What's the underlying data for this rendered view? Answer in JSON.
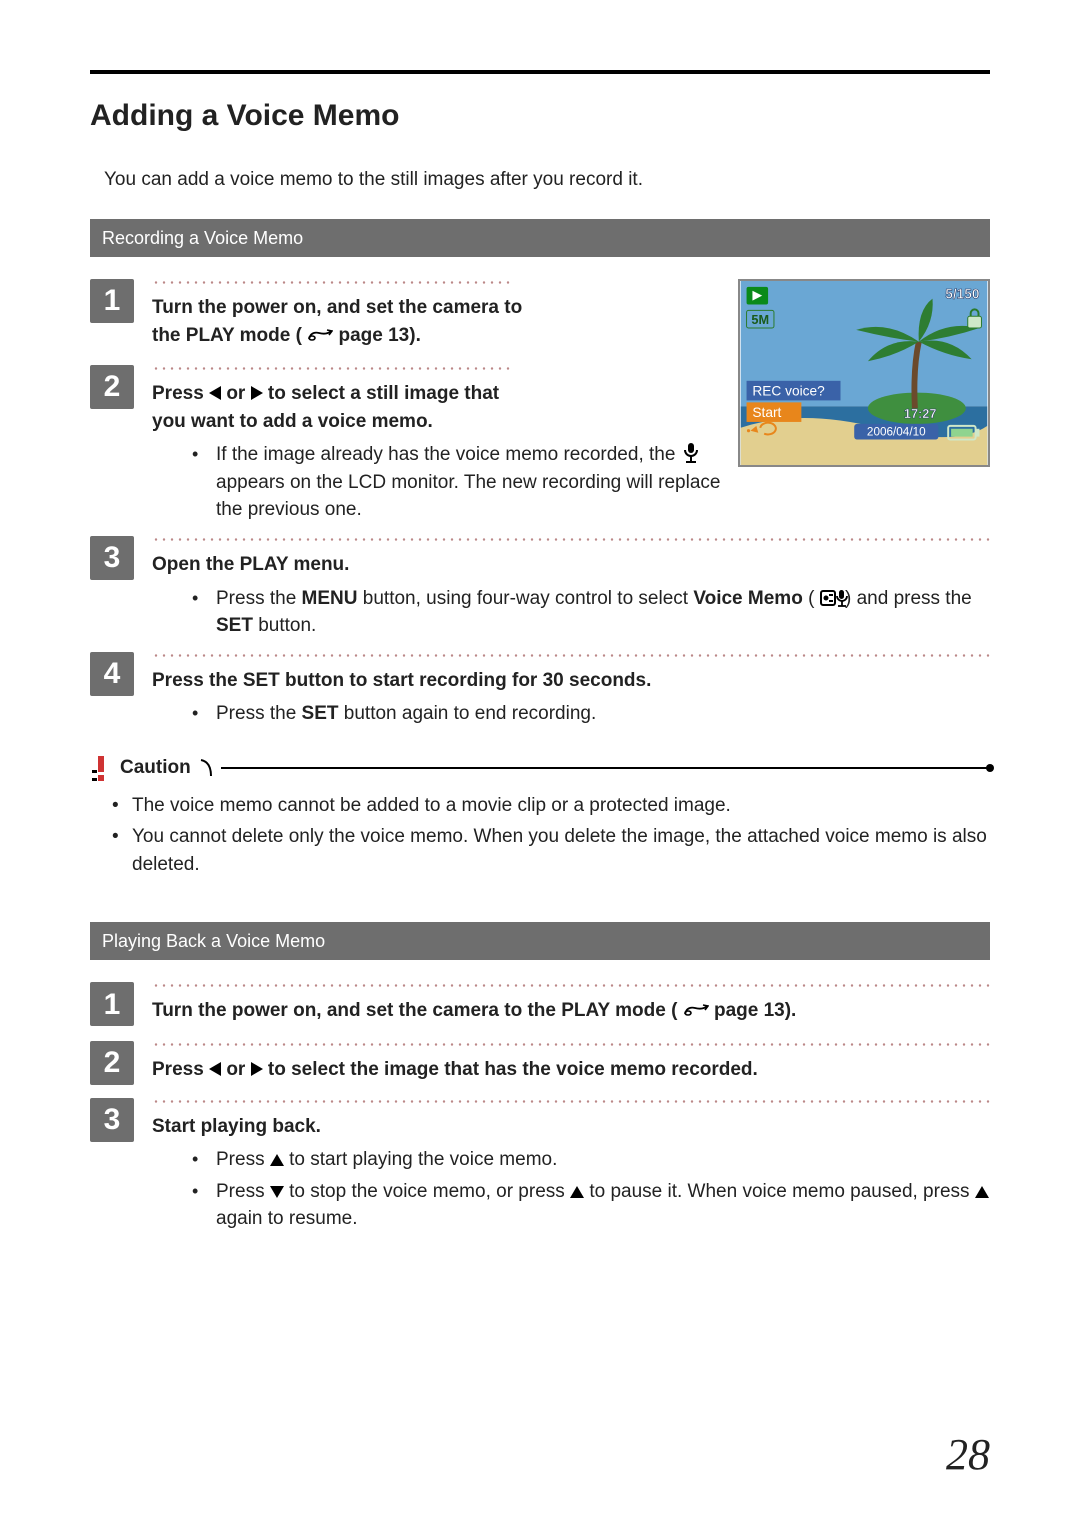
{
  "page": {
    "title": "Adding a Voice Memo",
    "intro": "You can add a voice memo to the still images after you record it.",
    "number": "28"
  },
  "section_a": {
    "title": "Recording a Voice Memo",
    "step1": {
      "n": "1",
      "lead_a": "Turn the power on, and set the camera to",
      "lead_b_pre": "the PLAY mode (",
      "lead_b_post": "page 13)."
    },
    "step2": {
      "n": "2",
      "lead_a_pre": "Press  ",
      "lead_a_mid": "  or  ",
      "lead_a_post": "  to select a still image that",
      "lead_b": "you want to add a voice memo.",
      "sub_a": "If the image already has the voice memo recorded, the ",
      "sub_b": " appears on the LCD monitor.  The new recording will replace the previous one."
    },
    "step3": {
      "n": "3",
      "lead": "Open the PLAY menu.",
      "sub_pre": "Press the ",
      "sub_menu": "MENU",
      "sub_mid1": " button, using four-way control to select ",
      "sub_vm": "Voice Memo",
      "sub_mid2": " (",
      "sub_post": ") and press the ",
      "sub_set": "SET",
      "sub_end": " button."
    },
    "step4": {
      "n": "4",
      "lead": "Press the SET button to start recording for 30 seconds.",
      "sub_pre": "Press the ",
      "sub_set": "SET",
      "sub_end": " button again to end recording."
    }
  },
  "lcd": {
    "counter": "5/150",
    "res": "5M",
    "prompt": "REC voice?",
    "start": "Start",
    "time": "17:27",
    "date": "2006/04/10"
  },
  "caution": {
    "label": "Caution",
    "items": [
      "The voice memo cannot be added to a movie clip or a protected image.",
      "You cannot delete only the voice memo. When you delete the image, the attached voice memo is also deleted."
    ]
  },
  "section_b": {
    "title": "Playing Back a Voice Memo",
    "step1": {
      "n": "1",
      "lead_pre": "Turn the power on, and set the camera to the PLAY mode (",
      "lead_post": "page 13)."
    },
    "step2": {
      "n": "2",
      "lead_pre": "Press  ",
      "lead_mid": "  or  ",
      "lead_post": "  to select the image that has the voice memo recorded."
    },
    "step3": {
      "n": "3",
      "lead": "Start playing back.",
      "sub1_pre": "Press  ",
      "sub1_post": "  to start playing the voice memo.",
      "sub2_pre": "Press  ",
      "sub2_mid": "  to stop the voice memo, or press  ",
      "sub2_post": "  to pause it. When voice memo paused, press  ",
      "sub2_end": "  again to resume."
    }
  }
}
